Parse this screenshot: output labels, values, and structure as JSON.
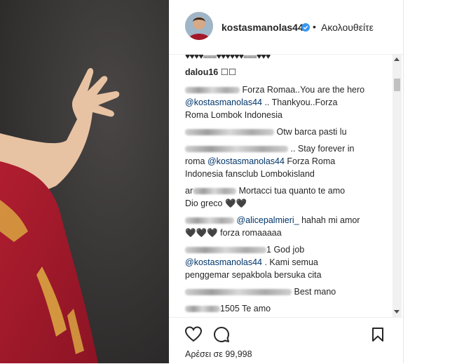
{
  "post": {
    "username": "kostasmanolas44",
    "dot": "•",
    "follow_label": "Ακολουθείτε",
    "likes_text": "Αρέσει σε 99,998"
  },
  "comments": {
    "top_row": "♥♥♥♥≡≡≡♥♥♥♥♥♥≡≡≡♥♥♥",
    "c1_user": "dalou16",
    "c1_text": "☐☐",
    "c2_text": "Forza Romaa..You are the hero",
    "c2_mention": "@kostasmanolas44",
    "c2_rest": ".. Thankyou..Forza",
    "c2_line3": "Roma Lombok Indonesia",
    "c3_text": "Otw barca pasti lu",
    "c4_text": ".. Stay forever in",
    "c4_l2a": "roma",
    "c4_mention": "@kostasmanolas44",
    "c4_l2b": "Forza Roma",
    "c4_l3": "Indonesia fansclub Lombokisland",
    "c5_user_part": "ar",
    "c5_text": "Mortacci tua quanto te amo",
    "c5_l2": "Dio greco 🖤🖤",
    "c6_mention": "@alicepalmieri_",
    "c6_text": "hahah mi amor",
    "c6_l2": "🖤🖤🖤 forza romaaaaa",
    "c7_user_part": "1",
    "c7_text": "God job",
    "c7_mention": "@kostasmanolas44",
    "c7_rest": ". Kami semua",
    "c7_l3": "penggemar sepakbola bersuka cita",
    "c8_text": "Best mano",
    "c9_user_part": "1505",
    "c9_text": "Te amo"
  },
  "colors": {
    "mention": "#003569",
    "verified": "#3897f0",
    "jersey_red": "#a3182b"
  },
  "icons": [
    "heart-icon",
    "comment-icon",
    "bookmark-icon",
    "verified-badge-icon"
  ]
}
